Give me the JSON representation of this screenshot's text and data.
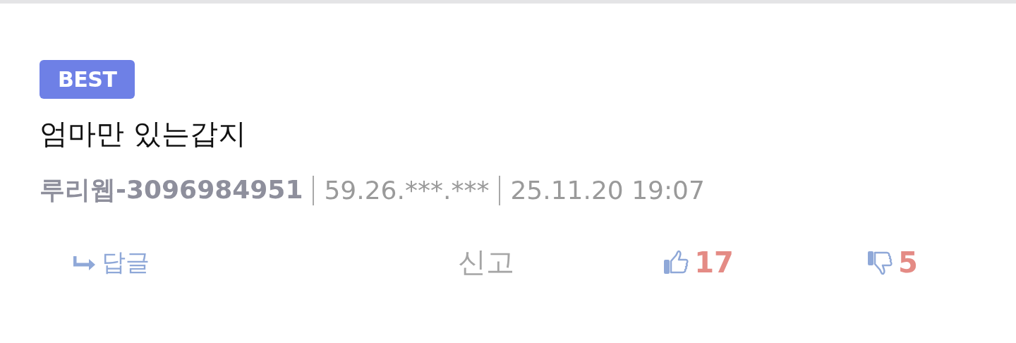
{
  "comment": {
    "badge": "BEST",
    "body": "엄마만 있는갑지",
    "author": "루리웹-3096984951",
    "ip": "59.26.***.***",
    "date": "25.11.20 19:07",
    "actions": [
      {
        "kind": "reply",
        "label": "답글"
      },
      {
        "kind": "report",
        "label": "신고"
      },
      {
        "kind": "like",
        "count": "17"
      },
      {
        "kind": "dislike",
        "count": "5"
      }
    ]
  }
}
